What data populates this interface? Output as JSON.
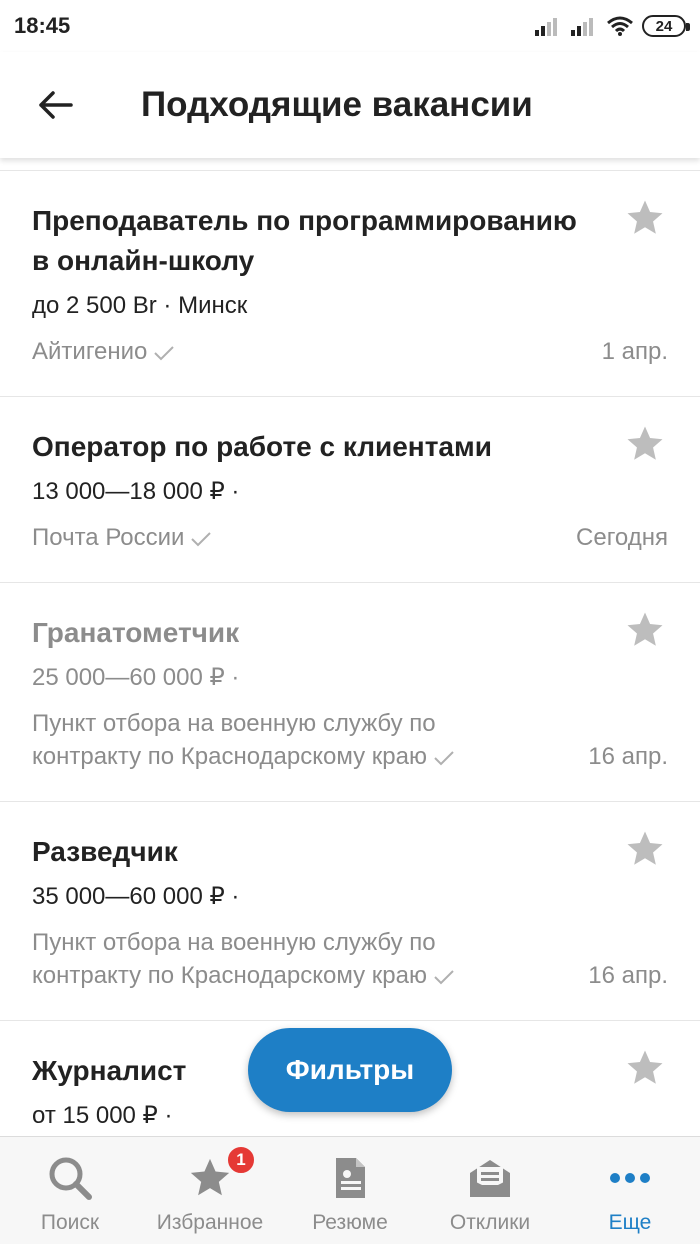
{
  "status_bar": {
    "time": "18:45",
    "battery": "24"
  },
  "header": {
    "title": "Подходящие вакансии"
  },
  "vacancies": [
    {
      "title": "Преподаватель по программированию в онлайн-школу",
      "salary": "до 2 500 Br · Минск",
      "company": "Айтигенио",
      "date": "1 апр.",
      "viewed": false
    },
    {
      "title": "Оператор по работе с клиентами",
      "salary": "13 000—18 000 ₽ ·",
      "company": "Почта России",
      "date": "Сегодня",
      "viewed": false
    },
    {
      "title": "Гранатометчик",
      "salary": "25 000—60 000 ₽ ·",
      "company": "Пункт отбора на военную службу по контракту по Краснодарскому краю",
      "date": "16 апр.",
      "viewed": true
    },
    {
      "title": "Разведчик",
      "salary": "35 000—60 000 ₽ ·",
      "company": "Пункт отбора на военную службу по контракту по Краснодарскому краю",
      "date": "16 апр.",
      "viewed": false
    },
    {
      "title": "Журналист",
      "salary": "от 15 000 ₽ ·",
      "company": "",
      "date": "",
      "viewed": false
    }
  ],
  "filter_button": {
    "label": "Фильтры"
  },
  "bottom_nav": {
    "items": [
      {
        "label": "Поиск",
        "icon": "search-icon"
      },
      {
        "label": "Избранное",
        "icon": "star-icon",
        "badge": "1"
      },
      {
        "label": "Резюме",
        "icon": "resume-icon"
      },
      {
        "label": "Отклики",
        "icon": "responses-icon"
      },
      {
        "label": "Еще",
        "icon": "more-icon",
        "active": true
      }
    ]
  },
  "colors": {
    "accent": "#1e7fc6",
    "badge": "#e53935",
    "muted": "#8c8c8c",
    "text": "#222222"
  }
}
